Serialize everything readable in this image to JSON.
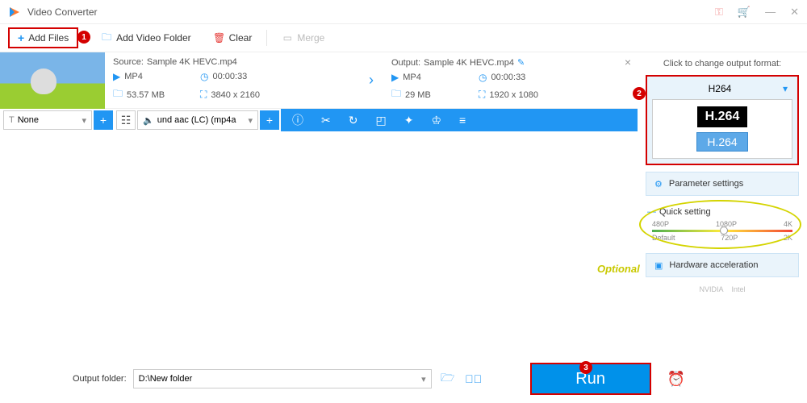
{
  "app": {
    "title": "Video Converter"
  },
  "toolbar": {
    "add_files": "Add Files",
    "add_folder": "Add Video Folder",
    "clear": "Clear",
    "merge": "Merge"
  },
  "file": {
    "source_label": "Source:",
    "source_name": "Sample 4K HEVC.mp4",
    "output_label": "Output:",
    "output_name": "Sample 4K HEVC.mp4",
    "src": {
      "format": "MP4",
      "duration": "00:00:33",
      "size": "53.57 MB",
      "resolution": "3840 x 2160"
    },
    "out": {
      "format": "MP4",
      "duration": "00:00:33",
      "size": "29 MB",
      "resolution": "1920 x 1080"
    }
  },
  "controls": {
    "subtitle": "None",
    "audio": "und aac (LC) (mp4a"
  },
  "sidebar": {
    "format_hint": "Click to change output format:",
    "format_name": "H264",
    "codec_black": "H.264",
    "codec_blue": "H.264",
    "param_settings": "Parameter settings",
    "quick_setting": "Quick setting",
    "presets_top": [
      "480P",
      "1080P",
      "4K"
    ],
    "presets_bottom": [
      "Default",
      "720P",
      "2K"
    ],
    "hw_accel": "Hardware acceleration",
    "hw_vendors": [
      "NVIDIA",
      "Intel"
    ]
  },
  "footer": {
    "label": "Output folder:",
    "path": "D:\\New folder",
    "run": "Run"
  },
  "annotations": {
    "b1": "1",
    "b2": "2",
    "b3": "3",
    "optional": "Optional"
  }
}
